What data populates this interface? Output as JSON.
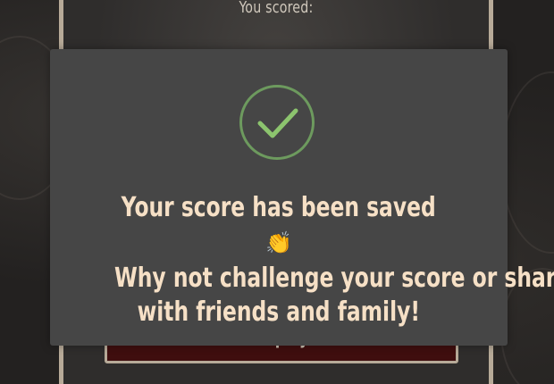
{
  "game": {
    "score_label": "You scored:",
    "replay_label": "Replay"
  },
  "modal": {
    "title": "Your score has been saved",
    "emoji": "👏",
    "message_line1": "Why not challenge your score or share",
    "message_line2": "with friends and family!",
    "check_color": "#8cc46e",
    "circle_color": "#6d9a5e",
    "text_color": "#f6e0c6",
    "card_color": "#464646"
  },
  "icons": {
    "success": "checkmark-circle-icon",
    "emoji": "clapping-hands-icon"
  }
}
